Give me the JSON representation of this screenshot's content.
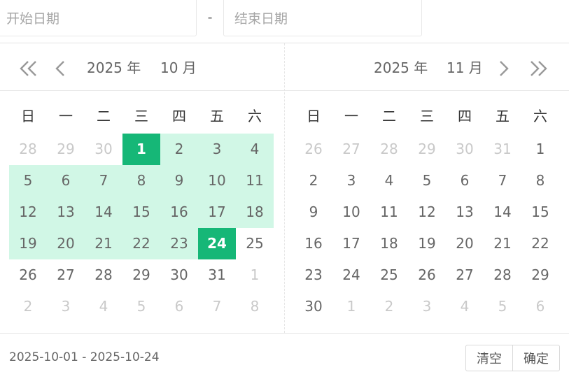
{
  "inputs": {
    "start_placeholder": "开始日期",
    "separator": "-",
    "end_placeholder": "结束日期"
  },
  "left": {
    "year_label": "2025 年",
    "month_label": "10 月",
    "weekdays": [
      "日",
      "一",
      "二",
      "三",
      "四",
      "五",
      "六"
    ],
    "days": [
      {
        "d": "28",
        "t": "other"
      },
      {
        "d": "29",
        "t": "other"
      },
      {
        "d": "30",
        "t": "other"
      },
      {
        "d": "1",
        "t": "sel"
      },
      {
        "d": "2",
        "t": "inrange"
      },
      {
        "d": "3",
        "t": "inrange"
      },
      {
        "d": "4",
        "t": "inrange"
      },
      {
        "d": "5",
        "t": "inrange"
      },
      {
        "d": "6",
        "t": "inrange"
      },
      {
        "d": "7",
        "t": "inrange"
      },
      {
        "d": "8",
        "t": "inrange"
      },
      {
        "d": "9",
        "t": "inrange"
      },
      {
        "d": "10",
        "t": "inrange"
      },
      {
        "d": "11",
        "t": "inrange"
      },
      {
        "d": "12",
        "t": "inrange"
      },
      {
        "d": "13",
        "t": "inrange"
      },
      {
        "d": "14",
        "t": "inrange"
      },
      {
        "d": "15",
        "t": "inrange"
      },
      {
        "d": "16",
        "t": "inrange"
      },
      {
        "d": "17",
        "t": "inrange"
      },
      {
        "d": "18",
        "t": "inrange"
      },
      {
        "d": "19",
        "t": "inrange"
      },
      {
        "d": "20",
        "t": "inrange"
      },
      {
        "d": "21",
        "t": "inrange"
      },
      {
        "d": "22",
        "t": "inrange"
      },
      {
        "d": "23",
        "t": "inrange"
      },
      {
        "d": "24",
        "t": "sel"
      },
      {
        "d": "25",
        "t": "cur"
      },
      {
        "d": "26",
        "t": "cur"
      },
      {
        "d": "27",
        "t": "cur"
      },
      {
        "d": "28",
        "t": "cur"
      },
      {
        "d": "29",
        "t": "cur"
      },
      {
        "d": "30",
        "t": "cur"
      },
      {
        "d": "31",
        "t": "cur"
      },
      {
        "d": "1",
        "t": "other"
      },
      {
        "d": "2",
        "t": "other"
      },
      {
        "d": "3",
        "t": "other"
      },
      {
        "d": "4",
        "t": "other"
      },
      {
        "d": "5",
        "t": "other"
      },
      {
        "d": "6",
        "t": "other"
      },
      {
        "d": "7",
        "t": "other"
      },
      {
        "d": "8",
        "t": "other"
      }
    ]
  },
  "right": {
    "year_label": "2025 年",
    "month_label": "11 月",
    "weekdays": [
      "日",
      "一",
      "二",
      "三",
      "四",
      "五",
      "六"
    ],
    "days": [
      {
        "d": "26",
        "t": "other"
      },
      {
        "d": "27",
        "t": "other"
      },
      {
        "d": "28",
        "t": "other"
      },
      {
        "d": "29",
        "t": "other"
      },
      {
        "d": "30",
        "t": "other"
      },
      {
        "d": "31",
        "t": "other"
      },
      {
        "d": "1",
        "t": "cur"
      },
      {
        "d": "2",
        "t": "cur"
      },
      {
        "d": "3",
        "t": "cur"
      },
      {
        "d": "4",
        "t": "cur"
      },
      {
        "d": "5",
        "t": "cur"
      },
      {
        "d": "6",
        "t": "cur"
      },
      {
        "d": "7",
        "t": "cur"
      },
      {
        "d": "8",
        "t": "cur"
      },
      {
        "d": "9",
        "t": "cur"
      },
      {
        "d": "10",
        "t": "cur"
      },
      {
        "d": "11",
        "t": "cur"
      },
      {
        "d": "12",
        "t": "cur"
      },
      {
        "d": "13",
        "t": "cur"
      },
      {
        "d": "14",
        "t": "cur"
      },
      {
        "d": "15",
        "t": "cur"
      },
      {
        "d": "16",
        "t": "cur"
      },
      {
        "d": "17",
        "t": "cur"
      },
      {
        "d": "18",
        "t": "cur"
      },
      {
        "d": "19",
        "t": "cur"
      },
      {
        "d": "20",
        "t": "cur"
      },
      {
        "d": "21",
        "t": "cur"
      },
      {
        "d": "22",
        "t": "cur"
      },
      {
        "d": "23",
        "t": "cur"
      },
      {
        "d": "24",
        "t": "cur"
      },
      {
        "d": "25",
        "t": "cur"
      },
      {
        "d": "26",
        "t": "cur"
      },
      {
        "d": "27",
        "t": "cur"
      },
      {
        "d": "28",
        "t": "cur"
      },
      {
        "d": "29",
        "t": "cur"
      },
      {
        "d": "30",
        "t": "cur"
      },
      {
        "d": "1",
        "t": "other"
      },
      {
        "d": "2",
        "t": "other"
      },
      {
        "d": "3",
        "t": "other"
      },
      {
        "d": "4",
        "t": "other"
      },
      {
        "d": "5",
        "t": "other"
      },
      {
        "d": "6",
        "t": "other"
      }
    ]
  },
  "icons": {
    "prev_year": "double-chevron-left-icon",
    "prev_month": "chevron-left-icon",
    "next_month": "chevron-right-icon",
    "next_year": "double-chevron-right-icon"
  },
  "footer": {
    "range_text": "2025-10-01 - 2025-10-24",
    "clear_label": "清空",
    "confirm_label": "确定"
  },
  "colors": {
    "selected": "#16b777",
    "in_range": "#d1f7e6",
    "other_month_text": "#c9c9c9"
  }
}
